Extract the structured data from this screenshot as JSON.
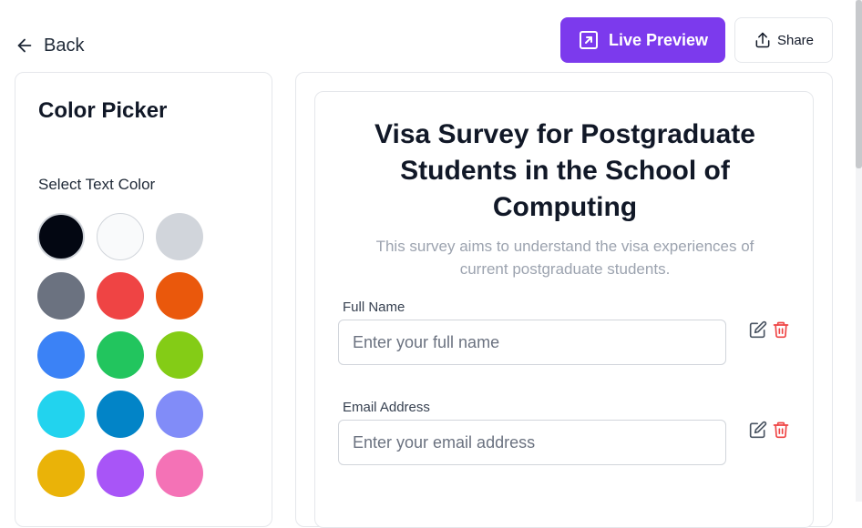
{
  "nav": {
    "back_label": "Back"
  },
  "header": {
    "live_preview_label": "Live Preview",
    "share_label": "Share"
  },
  "color_picker": {
    "title": "Color Picker",
    "subtitle": "Select Text Color",
    "swatches": [
      {
        "name": "black",
        "color": "#030712",
        "selected": true
      },
      {
        "name": "white",
        "color": "#f9fafb"
      },
      {
        "name": "light-gray",
        "color": "#d1d5db"
      },
      {
        "name": "gray",
        "color": "#6b7280"
      },
      {
        "name": "red",
        "color": "#ef4444"
      },
      {
        "name": "orange",
        "color": "#ea580c"
      },
      {
        "name": "blue",
        "color": "#3b82f6"
      },
      {
        "name": "green",
        "color": "#22c55e"
      },
      {
        "name": "lime",
        "color": "#84cc16"
      },
      {
        "name": "cyan",
        "color": "#22d3ee"
      },
      {
        "name": "sky-blue",
        "color": "#0284c7"
      },
      {
        "name": "indigo",
        "color": "#818cf8"
      },
      {
        "name": "yellow",
        "color": "#eab308"
      },
      {
        "name": "purple",
        "color": "#a855f7"
      },
      {
        "name": "pink",
        "color": "#f472b6"
      }
    ]
  },
  "form": {
    "title_lines": [
      "Visa Survey for Postgraduate",
      "Students in the School of",
      "Computing"
    ],
    "description_lines": [
      "This survey aims to understand the visa experiences of",
      "current postgraduate students."
    ],
    "fields": [
      {
        "label": "Full Name",
        "placeholder": "Enter your full name",
        "value": ""
      },
      {
        "label": "Email Address",
        "placeholder": "Enter your email address",
        "value": ""
      }
    ]
  },
  "colors": {
    "accent": "#7c3aed",
    "delete": "#ef4444",
    "border": "#e5e7eb",
    "muted_text": "#9ca3af"
  }
}
